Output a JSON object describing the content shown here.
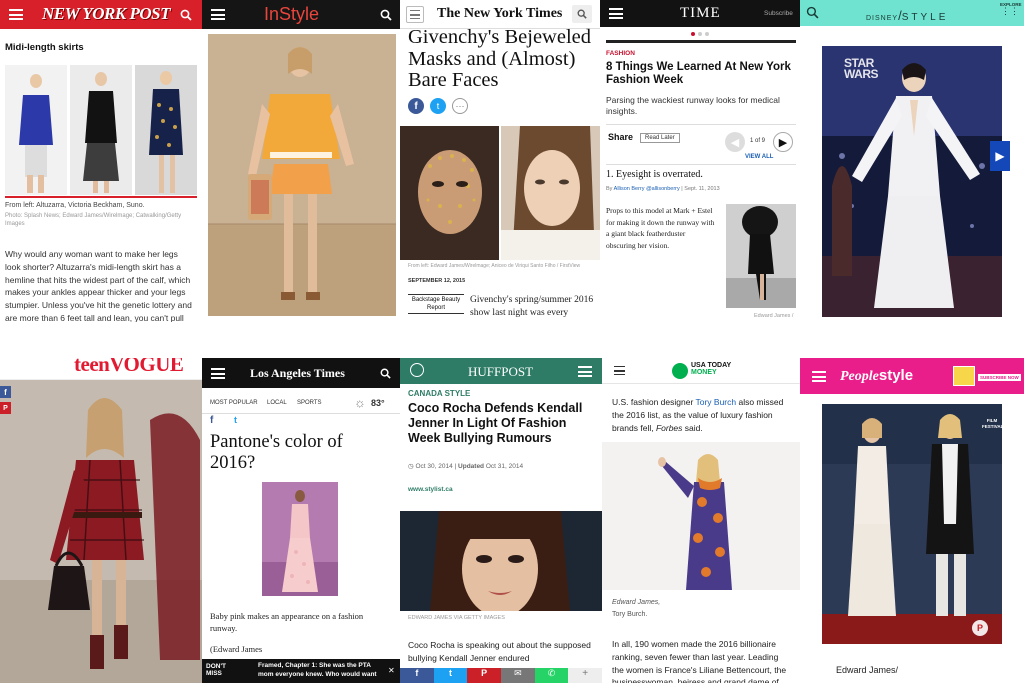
{
  "nyp": {
    "logo": "NEW YORK POST",
    "heading": "Midi-length skirts",
    "caption": "From left: Altuzarra, Victoria Beckham, Suno.",
    "credit": "Photo: Splash News; Edward James/Wirelmage; Catwalking/Getty Images",
    "body": "Why would any woman want to make her legs look shorter? Altuzarra's midi-length skirt has a hemline that hits the widest part of the calf, which makes your ankles appear thicker and your legs stumpier. Unless you've hit the genetic lottery and are more than 6 feet tall and lean, you can't pull"
  },
  "instyle": {
    "logo": "InStyle"
  },
  "nyt": {
    "logo": "The New York Times",
    "headline": "Givenchy's Bejeweled Masks and (Almost) Bare Faces",
    "credit": "From left: Edward James/Wirelmage; Aniceo de Viriqui Santo Filho / FirstView",
    "date": "SEPTEMBER 12, 2015",
    "section": "Backstage Beauty Report",
    "body": "Givenchy's spring/summer 2016 show last night was every"
  },
  "time": {
    "logo": "TIME",
    "subscribe": "Subscribe",
    "section": "FASHION",
    "headline": "8 Things We Learned At New York Fashion Week",
    "dek": "Parsing the wackiest runway looks for medical insights.",
    "share": "Share",
    "read_later": "Read Later",
    "pager": "1 of 9",
    "view_all": "VIEW ALL",
    "item_title": "1. Eyesight is overrated.",
    "byline_prefix": "By",
    "author": "Allison Berry",
    "handle": "@allisonberry",
    "date": "Sept. 11, 2013",
    "body": "Props to this model at Mark + Estel for making it down the runway with a giant black featherduster obscuring her vision.",
    "photo_credit": "Edward James /"
  },
  "disney": {
    "brand": "DISNEY",
    "style": "STYLE",
    "explore": "EXPLORE",
    "sign": "STAR WARS"
  },
  "teenvogue": {
    "logo": "teenVOGUE"
  },
  "lat": {
    "logo": "Los Angeles Times",
    "nav": [
      "MOST POPULAR",
      "LOCAL",
      "SPORTS"
    ],
    "temp": "83°",
    "headline": "Pantone's color of 2016?",
    "caption": "Baby pink makes an appearance on a fashion runway.",
    "credit": "(Edward James",
    "dont_miss": "DON'T MISS",
    "promo": "Framed, Chapter 1: She was the PTA mom everyone knew. Who would want"
  },
  "huff": {
    "logo": "HUFFPOST",
    "section": "CANADA STYLE",
    "headline": "Coco Rocha Defends Kendall Jenner In Light Of Fashion Week Bullying Rumours",
    "date": "Oct 30, 2014",
    "updated_label": "Updated",
    "updated": "Oct 31, 2014",
    "source": "www.stylist.ca",
    "credit": "EDWARD JAMES VIA GETTY IMAGES",
    "body": "Coco Rocha is speaking out about the supposed bullying Kendall Jenner endured"
  },
  "usat": {
    "logo_top": "USA TODAY",
    "logo_sub": "MONEY",
    "intro_a": "U.S. fashion designer ",
    "intro_link": "Tory Burch",
    "intro_b": " also missed the 2016 list, as the value of luxury fashion brands fell, ",
    "intro_em": "Forbes",
    "intro_c": " said.",
    "credit_1": "Edward James,",
    "credit_2": "Tory Burch.",
    "body": "In all, 190 women made the 2016 billionaire ranking, seven fewer than last year. Leading the women is France's Liliane Bettencourt, the businesswoman, heiress and grand dame of"
  },
  "people": {
    "logo_a": "People",
    "logo_b": "style",
    "subscribe": "SUBSCRIBE NOW",
    "film": "FILM",
    "festival": "FESTIVAL",
    "credit": "Edward James/"
  },
  "colors": {
    "nyp_red": "#d8202a",
    "time_red": "#c8102e",
    "disney_mint": "#6fe3cf",
    "huff_green": "#2e7c66",
    "people_pink": "#ea1e8a",
    "usat_green": "#00b04f",
    "link_blue": "#1a5fb4"
  }
}
